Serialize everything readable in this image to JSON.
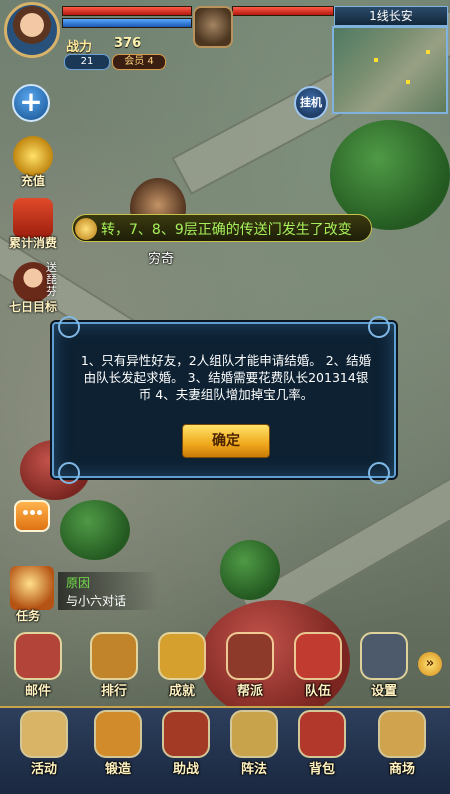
{
  "hud": {
    "power_label": "战力",
    "power_value": "376",
    "level": "21",
    "vip": "会员 4",
    "server": "1线长安",
    "auto_button": "挂机"
  },
  "side_buttons": [
    {
      "id": "recharge",
      "label": "充值",
      "icon": "gold-coin-icon"
    },
    {
      "id": "cumulative",
      "label": "累计消费",
      "icon": "gift-box-icon"
    },
    {
      "id": "seven-day",
      "label": "七日目标",
      "icon": "girl-portrait-icon"
    }
  ],
  "side_hint_vertical": "送琵芬",
  "notice": {
    "text": "转，7、8、9层正确的传送门发生了改变"
  },
  "npc": {
    "name": "穷奇"
  },
  "dialog": {
    "message": "1、只有异性好友，2人组队才能申请结婚。 2、结婚由队长发起求婚。 3、结婚需要花费队长201314银币 4、夫妻组队增加掉宝几率。",
    "confirm_label": "确定"
  },
  "quest": {
    "category": "任务",
    "title": "原因",
    "description": "与小六对话"
  },
  "menu_row_1": [
    {
      "label": "邮件",
      "icon": "mail-icon",
      "color": "#b2443a"
    },
    {
      "label": "排行",
      "icon": "ranking-icon",
      "color": "#c2842a"
    },
    {
      "label": "成就",
      "icon": "achievement-icon",
      "color": "#d6a02f"
    },
    {
      "label": "帮派",
      "icon": "guild-icon",
      "color": "#8d3a2a"
    },
    {
      "label": "队伍",
      "icon": "team-icon",
      "color": "#c23b30"
    },
    {
      "label": "设置",
      "icon": "settings-icon",
      "color": "#4c5a6b"
    }
  ],
  "menu_row_2": [
    {
      "label": "活动",
      "icon": "activity-icon",
      "color": "#d9b466"
    },
    {
      "label": "锻造",
      "icon": "forge-icon",
      "color": "#d28b2a"
    },
    {
      "label": "助战",
      "icon": "assist-icon",
      "color": "#a33a26"
    },
    {
      "label": "阵法",
      "icon": "formation-icon",
      "color": "#c9a24c"
    },
    {
      "label": "背包",
      "icon": "backpack-icon",
      "color": "#b3382c"
    },
    {
      "label": "商场",
      "icon": "shop-icon",
      "color": "#d0a34e"
    }
  ],
  "more_arrow": "»",
  "colors": {
    "notice_text": "#a6f05a",
    "quest_title": "#73e04a",
    "dialog_border": "#5f9fd2",
    "button_gold": "#f0a81c"
  }
}
